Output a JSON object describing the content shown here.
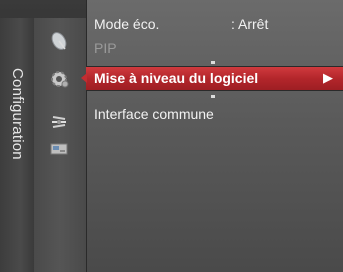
{
  "sidebar": {
    "label": "Configuration",
    "icons": [
      "satellite-dish-icon",
      "gear-icon",
      "antenna-icon",
      "input-source-icon"
    ]
  },
  "menu": {
    "items": [
      {
        "label": "Mode éco.",
        "value": ": Arrêt",
        "state": "normal"
      },
      {
        "label": "PIP",
        "state": "disabled"
      },
      {
        "label": "Mise à niveau du logiciel",
        "state": "selected",
        "arrow": "▶"
      },
      {
        "label": "Interface commune",
        "state": "normal"
      }
    ]
  },
  "colors": {
    "selection": "#b3262b",
    "panel": "#5f5f5f",
    "text": "#f2f2f2",
    "disabled_text": "#9a9a9a"
  }
}
